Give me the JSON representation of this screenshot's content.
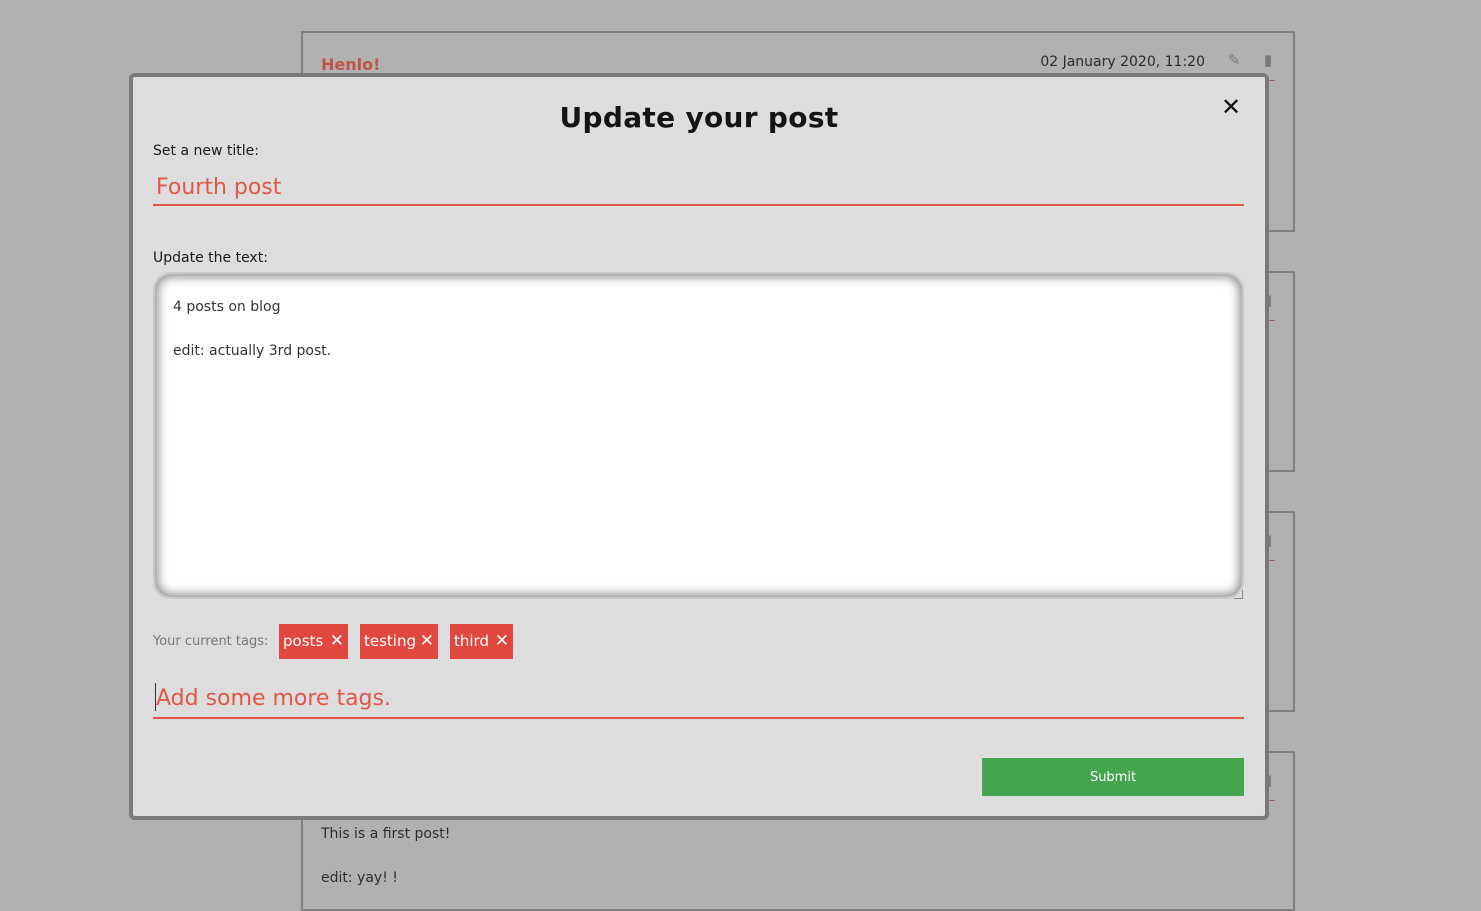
{
  "background_posts": [
    {
      "title": "Henlo!",
      "date": "02 January 2020, 11:20"
    },
    {
      "body_lines": [
        "This is a first post!",
        "edit: yay! !"
      ]
    }
  ],
  "modal": {
    "title": "Update your post",
    "close_label": "✕",
    "title_label": "Set a new title:",
    "title_value": "Fourth post",
    "text_label": "Update the text:",
    "text_value": "4 posts on blog\n\nedit: actually 3rd post.",
    "tags_label": "Your current tags:",
    "tags": [
      "posts",
      "testing",
      "third"
    ],
    "tag_remove": "✕",
    "new_tags_placeholder": "Add some more tags.",
    "submit_label": "Submit"
  },
  "colors": {
    "accent": "#e0564b",
    "tag_bg": "#e0473e",
    "submit_bg": "#43a64f",
    "modal_bg": "#dddddd",
    "page_bg": "#b1b1b1"
  }
}
